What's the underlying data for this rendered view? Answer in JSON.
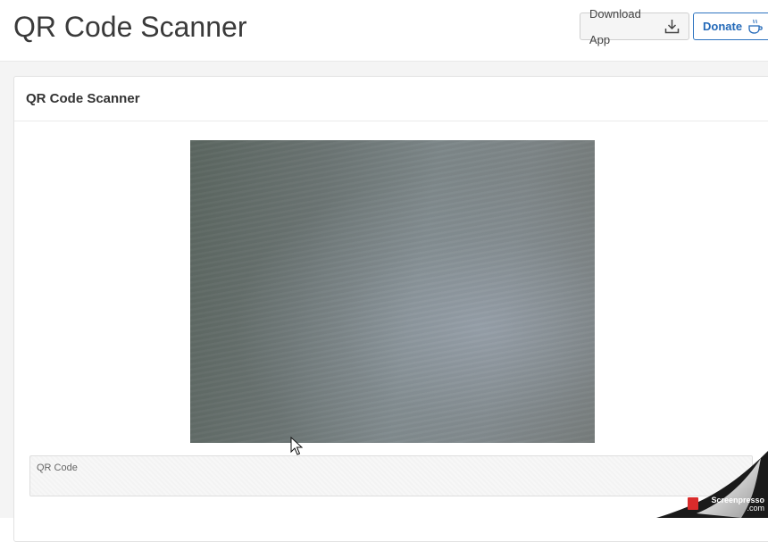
{
  "header": {
    "title": "QR Code Scanner",
    "download_label": "Download App",
    "donate_label": "Donate"
  },
  "panel": {
    "title": "QR Code Scanner",
    "qr_field_label": "QR Code"
  },
  "watermark": {
    "brand": "Screenpresso",
    "domain": ".com"
  },
  "colors": {
    "accent": "#2369b8",
    "watermark_logo": "#d92b2b"
  },
  "icons": {
    "download": "download-icon",
    "donate": "coffee-cup-icon"
  }
}
